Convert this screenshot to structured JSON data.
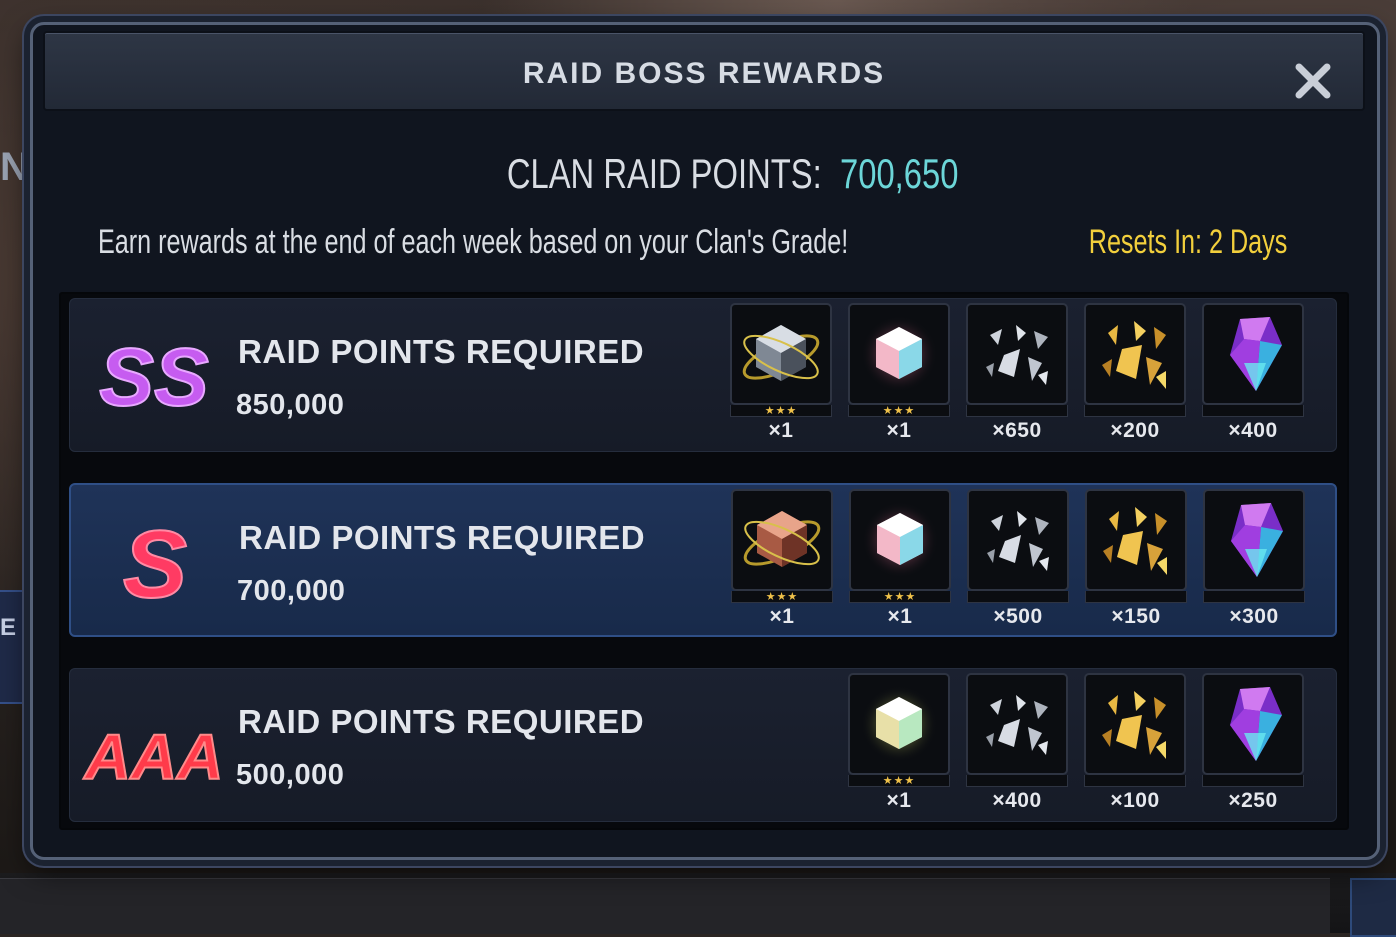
{
  "modal": {
    "title": "RAID BOSS REWARDS",
    "close_icon": "close-icon"
  },
  "summary": {
    "points_label": "CLAN RAID POINTS:",
    "points_value": "700,650",
    "description": "Earn rewards at the end of each week based on your Clan's Grade!",
    "resets": "Resets In:  2 Days"
  },
  "colors": {
    "accent_teal": "#6cd6d8",
    "resets_yellow": "#f2cf3c",
    "active_row": "#1f3358",
    "grade_ss": "#c65cf0",
    "grade_s": "#ff3b63",
    "grade_aaa": "#ff3b4a",
    "stars": "#f0c24a"
  },
  "tiers": [
    {
      "grade": "SS",
      "label": "RAID POINTS REQUIRED",
      "points": "850,000",
      "active": false,
      "rewards": [
        {
          "icon": "silver-cube-icon",
          "stars": "★★★",
          "qty": "×1"
        },
        {
          "icon": "crystal-cube-icon",
          "stars": "★★★",
          "qty": "×1"
        },
        {
          "icon": "shards-icon",
          "stars": "",
          "qty": "×650"
        },
        {
          "icon": "gold-shards-icon",
          "stars": "",
          "qty": "×200"
        },
        {
          "icon": "purple-crystal-icon",
          "stars": "",
          "qty": "×400"
        }
      ]
    },
    {
      "grade": "S",
      "label": "RAID POINTS REQUIRED",
      "points": "700,000",
      "active": true,
      "rewards": [
        {
          "icon": "bronze-cube-icon",
          "stars": "★★★",
          "qty": "×1"
        },
        {
          "icon": "crystal-cube-icon",
          "stars": "★★★",
          "qty": "×1"
        },
        {
          "icon": "shards-icon",
          "stars": "",
          "qty": "×500"
        },
        {
          "icon": "gold-shards-icon",
          "stars": "",
          "qty": "×150"
        },
        {
          "icon": "purple-crystal-icon",
          "stars": "",
          "qty": "×300"
        }
      ]
    },
    {
      "grade": "AAA",
      "label": "RAID POINTS REQUIRED",
      "points": "500,000",
      "active": false,
      "rewards": [
        {
          "icon": "gold-crystal-icon",
          "stars": "★★★",
          "qty": "×1"
        },
        {
          "icon": "shards-icon",
          "stars": "",
          "qty": "×400"
        },
        {
          "icon": "gold-shards-icon",
          "stars": "",
          "qty": "×100"
        },
        {
          "icon": "purple-crystal-icon",
          "stars": "",
          "qty": "×250"
        }
      ]
    }
  ]
}
